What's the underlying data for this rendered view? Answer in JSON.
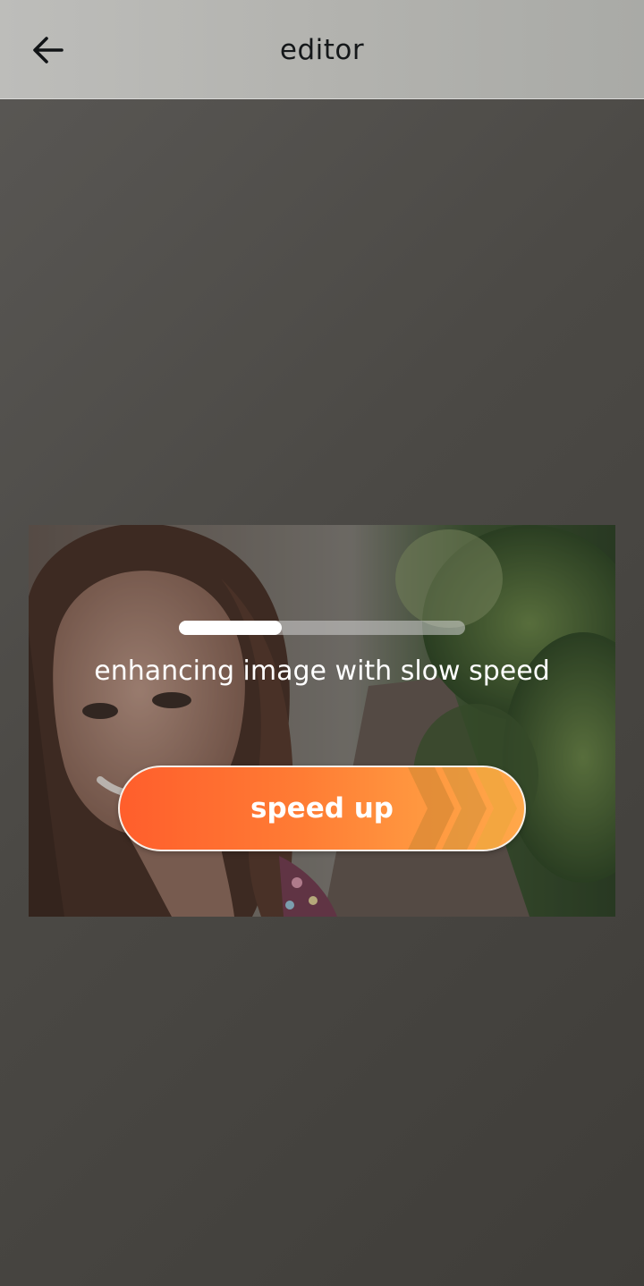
{
  "header": {
    "title": "editor",
    "back_icon": "arrow-left-icon"
  },
  "processing": {
    "progress_fraction": 0.36,
    "status_text": "enhancing image with slow speed",
    "speed_up_label": "speed up",
    "speed_icon": "fast-forward-chevrons-icon"
  },
  "colors": {
    "header_bg": "#b3b3af",
    "button_start": "#ff5e2c",
    "button_end": "#ffa84a",
    "overlay": "#4b4945"
  }
}
